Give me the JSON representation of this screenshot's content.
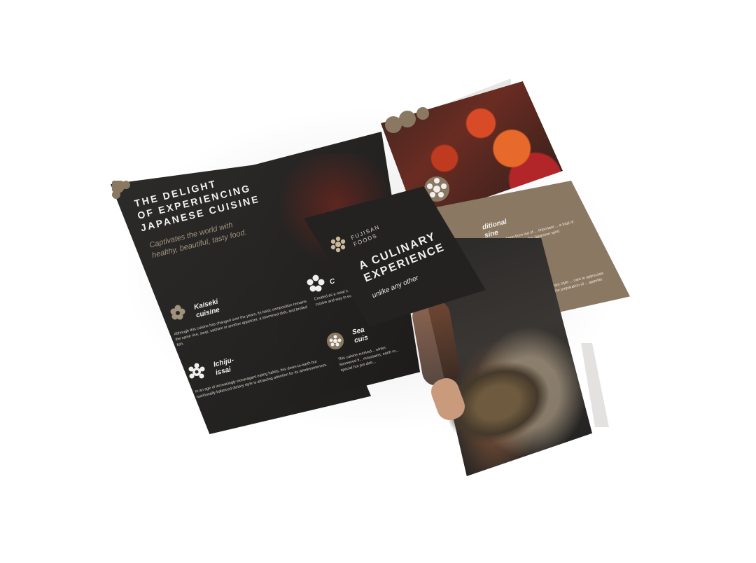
{
  "left_panel": {
    "heading": [
      "THE DELIGHT",
      "OF EXPERIENCING",
      "JAPANESE CUISINE"
    ],
    "tagline": [
      "Captivates the world with",
      "healthy, beautiful, tasty food."
    ],
    "items": [
      {
        "title": [
          "Kaiseki",
          "cuisine"
        ],
        "body": "Although this cuisine has changed over the years, its basic composition remains the same rice, soup, sashimi or another appetizer, a simmered dish, and broiled fish."
      },
      {
        "title": [
          "Ichiju-",
          "issai"
        ],
        "body": "In an age of increasingly extravagant eating habits, this down-to-earth but nutritionally balanced dietary style is attracting attention for its wholesomeness."
      }
    ]
  },
  "middle_panel": {
    "items": [
      {
        "title": [
          "C"
        ],
        "body": "Created as a meal is not just cuisine and way to eat."
      },
      {
        "title": [
          "Sea",
          "cuis"
        ],
        "body": "This cuisine evolved... winter. Simmered fi... mountains, earth ro... special hot pot dish..."
      }
    ]
  },
  "right_panel": {
    "item_title": [
      "ditional",
      "sine"
    ],
    "body_top": "has been born out of ... important ... a total of rising and ... ing the Japanese spirit.",
    "body_bottom": "... simple dietary style ... care to appreciate the ... some the preparation of ... appetite manner."
  },
  "cover": {
    "brand": [
      "FUJISAN",
      "FOODS"
    ],
    "title": [
      "A CULINARY",
      "EXPERIENCE"
    ],
    "subtitle": "unlike any other"
  },
  "colors": {
    "dark": "#232221",
    "tan": "#8a7862",
    "accent_text": "#a0927d",
    "light": "#f2f0ec"
  },
  "icons": [
    "flower-icon"
  ]
}
